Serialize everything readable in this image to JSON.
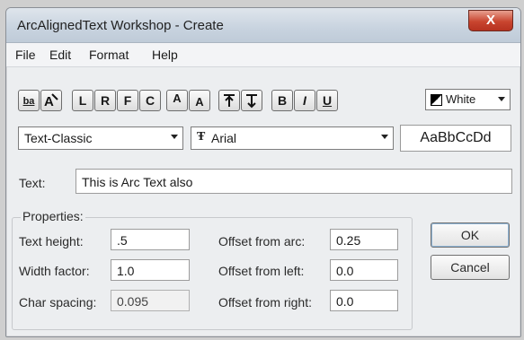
{
  "window": {
    "title": "ArcAlignedText Workshop - Create",
    "close_label": "X"
  },
  "menu": {
    "items": [
      "File",
      "Edit",
      "Format",
      "Help"
    ]
  },
  "toolbar": {
    "buttons": [
      "ba",
      "",
      "L",
      "R",
      "F",
      "C",
      "A",
      "A",
      "",
      "",
      "B",
      "I",
      "U"
    ],
    "color_value": "White"
  },
  "style_combo": {
    "value": "Text-Classic"
  },
  "font_combo": {
    "value": "Arial"
  },
  "preview": {
    "text": "AaBbCcDd"
  },
  "text_field": {
    "label": "Text:",
    "value": "This is Arc Text also"
  },
  "properties": {
    "group_label": "Properties:",
    "text_height": {
      "label": "Text height:",
      "value": ".5"
    },
    "width_factor": {
      "label": "Width factor:",
      "value": "1.0"
    },
    "char_spacing": {
      "label": "Char spacing:",
      "value": "0.095"
    },
    "offset_arc": {
      "label": "Offset from arc:",
      "value": "0.25"
    },
    "offset_left": {
      "label": "Offset from left:",
      "value": "0.0"
    },
    "offset_right": {
      "label": "Offset from right:",
      "value": "0.0"
    }
  },
  "buttons": {
    "ok": "OK",
    "cancel": "Cancel"
  }
}
